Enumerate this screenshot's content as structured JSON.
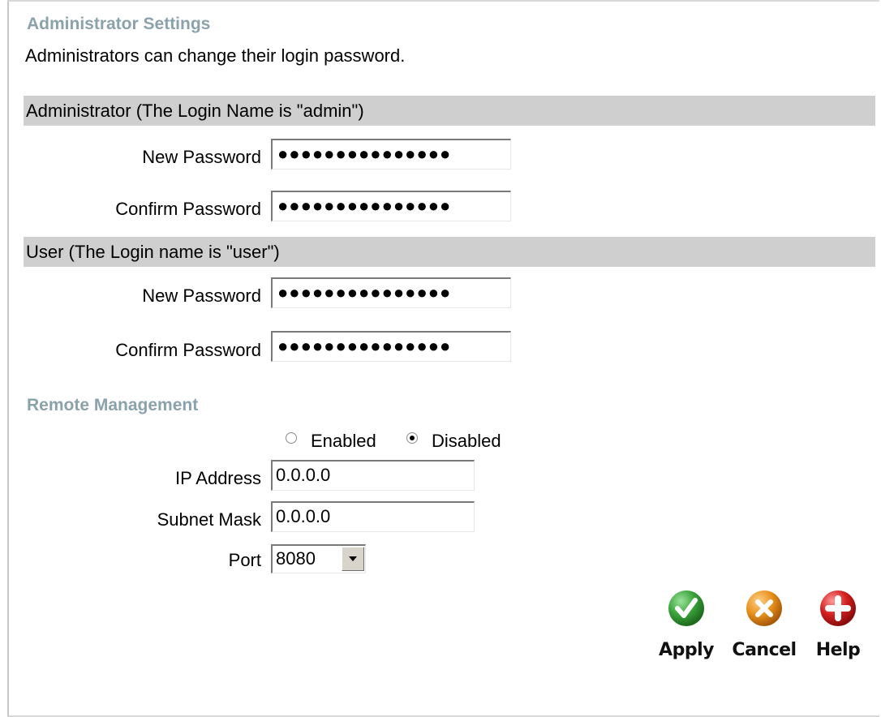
{
  "admin_settings": {
    "title": "Administrator Settings",
    "description": "Administrators can change their login password."
  },
  "admin_section": {
    "header": "Administrator (The Login Name is \"admin\")",
    "new_password_label": "New Password",
    "new_password_value": "●●●●●●●●●●●●●●●",
    "confirm_password_label": "Confirm Password",
    "confirm_password_value": "●●●●●●●●●●●●●●●"
  },
  "user_section": {
    "header": "User (The Login name is \"user\")",
    "new_password_label": "New Password",
    "new_password_value": "●●●●●●●●●●●●●●●",
    "confirm_password_label": "Confirm Password",
    "confirm_password_value": "●●●●●●●●●●●●●●●"
  },
  "remote_management": {
    "title": "Remote Management",
    "enabled_label": "Enabled",
    "disabled_label": "Disabled",
    "selected": "Disabled",
    "ip_label": "IP Address",
    "ip_value": "0.0.0.0",
    "subnet_label": "Subnet Mask",
    "subnet_value": "0.0.0.0",
    "port_label": "Port",
    "port_value": "8080"
  },
  "actions": {
    "apply_label": "Apply",
    "cancel_label": "Cancel",
    "help_label": "Help"
  },
  "colors": {
    "section_title": "#8aa2ab",
    "header_bar": "#cfcfcf",
    "apply": "#3aa33a",
    "cancel": "#e8921c",
    "help": "#d42020"
  },
  "icons": {
    "apply": "check-icon",
    "cancel": "x-icon",
    "help": "plus-icon"
  }
}
